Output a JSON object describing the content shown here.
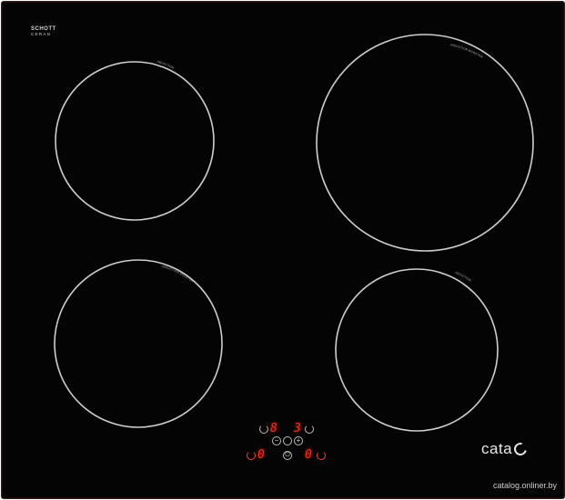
{
  "brand": {
    "logo_text": "cata",
    "glass_maker_line1": "SCHOTT",
    "glass_maker_line2": "CERAN"
  },
  "zones": [
    {
      "id": "rear-left",
      "label": "INDUCTION"
    },
    {
      "id": "rear-right",
      "label": "INDUCTION BOOSTER"
    },
    {
      "id": "front-left",
      "label": "INDUCTION BOOSTER"
    },
    {
      "id": "front-right",
      "label": "INDUCTION"
    }
  ],
  "controls": {
    "rear_left_level": "8",
    "rear_right_level": "3",
    "front_left_level": "0",
    "front_right_level": "0",
    "minus_symbol": "−",
    "plus_symbol": "+",
    "power_symbol": "⏻"
  },
  "watermark": "catalog.onliner.by",
  "colors": {
    "glass": "#050404",
    "zone_ring": "#cfcfcf",
    "display_red": "#ff2a1a",
    "frame": "#3a1a14"
  }
}
